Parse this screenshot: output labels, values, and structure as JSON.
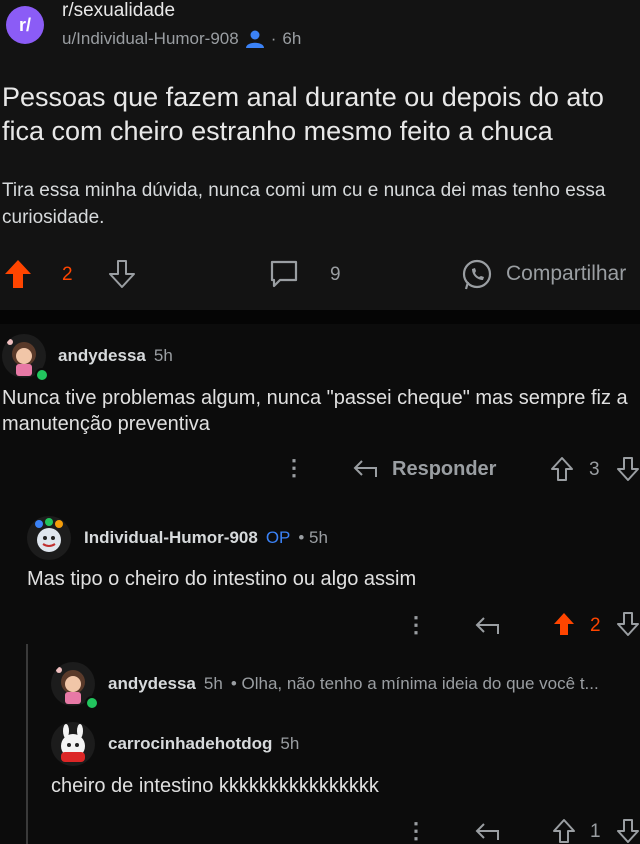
{
  "post": {
    "subreddit": "r/sexualidade",
    "subreddit_icon": "r/",
    "author": "u/Individual-Humor-908",
    "age": "6h",
    "title": "Pessoas que fazem anal durante ou depois do ato fica com cheiro estranho mesmo feito a chuca",
    "body": "Tira essa minha dúvida, nunca comi um cu e nunca dei mas tenho essa curiosidade.",
    "score": "2",
    "comments": "9",
    "share_label": "Compartilhar"
  },
  "comments": [
    {
      "username": "andydessa",
      "age": "5h",
      "text": "Nunca tive problemas algum, nunca \"passei cheque\" mas sempre fiz a manutenção preventiva",
      "reply_label": "Responder",
      "score": "3"
    },
    {
      "username": "Individual-Humor-908",
      "op_badge": "OP",
      "age": "• 5h",
      "text": "Mas tipo o cheiro do intestino ou algo assim",
      "score": "2"
    },
    {
      "username": "andydessa",
      "age": "5h",
      "preview": "• Olha, não tenho a mínima ideia do que você t..."
    },
    {
      "username": "carrocinhadehotdog",
      "age": "5h",
      "text": "cheiro de intestino kkkkkkkkkkkkkkkk",
      "score": "1"
    }
  ],
  "colors": {
    "background": "#0c0c0c",
    "post_background": "#131313",
    "upvote_active": "#ff4500",
    "op_badge": "#3b82f6",
    "subreddit_icon": "#8b5cf6",
    "online_dot": "#22c55e"
  }
}
